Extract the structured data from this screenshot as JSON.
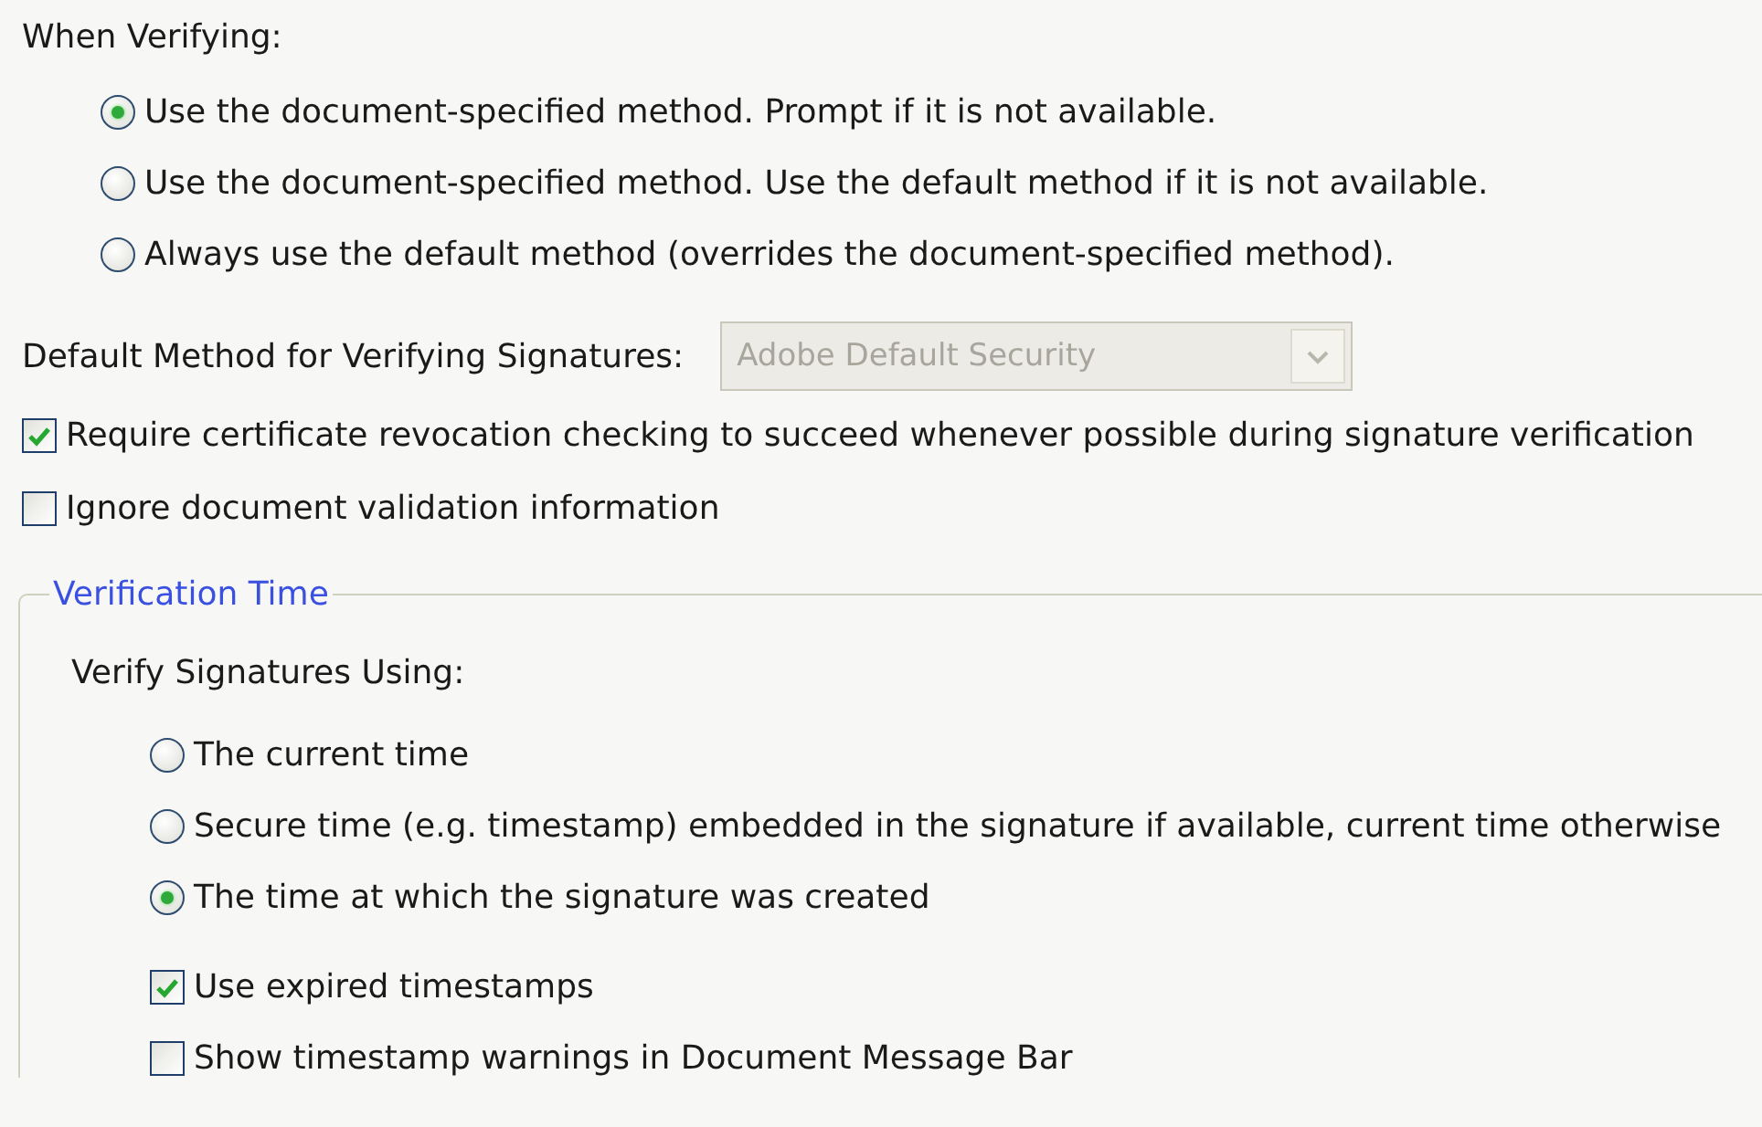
{
  "when_verifying": {
    "heading": "When Verifying:",
    "options": [
      {
        "label": "Use the document-specified method. Prompt if it is not available.",
        "selected": true
      },
      {
        "label": "Use the document-specified method. Use the default method if it is not available.",
        "selected": false
      },
      {
        "label": "Always use the default method (overrides the document-specified method).",
        "selected": false
      }
    ]
  },
  "default_method": {
    "label": "Default Method for Verifying Signatures:",
    "value": "Adobe Default Security",
    "disabled": true
  },
  "checks": [
    {
      "label": "Require certificate revocation checking to succeed whenever possible during signature verification",
      "checked": true
    },
    {
      "label": "Ignore document validation information",
      "checked": false
    }
  ],
  "verification_time": {
    "legend": "Verification Time",
    "heading": "Verify Signatures Using:",
    "options": [
      {
        "label": "The current time",
        "selected": false
      },
      {
        "label": "Secure time (e.g. timestamp) embedded in the signature if available, current time otherwise",
        "selected": false
      },
      {
        "label": "The time at which the signature was created",
        "selected": true
      }
    ],
    "checks": [
      {
        "label": "Use expired timestamps",
        "checked": true
      },
      {
        "label": "Show timestamp warnings in Document Message Bar",
        "checked": false
      }
    ]
  }
}
